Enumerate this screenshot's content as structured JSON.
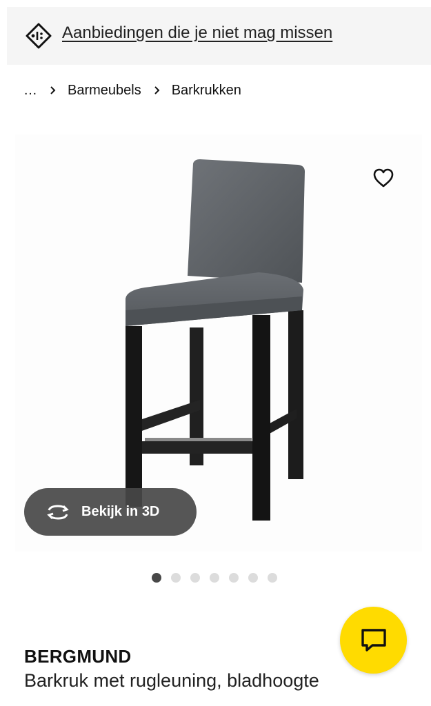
{
  "promo": {
    "icon": "tag-percent-icon",
    "link_text": "Aanbiedingen die je niet mag missen"
  },
  "breadcrumb": {
    "items": [
      "…",
      "Barmeubels",
      "Barkrukken"
    ]
  },
  "gallery": {
    "image_alt": "BERGMUND barkruk",
    "view_3d_label": "Bekijk in 3D",
    "slides_total": 7,
    "active_slide": 1
  },
  "product": {
    "name": "BERGMUND",
    "description": "Barkruk met rugleuning, bladhoogte"
  },
  "colors": {
    "accent_yellow": "#ffdb00",
    "promo_bg": "#f5f5f5",
    "pill_bg": "#484848"
  }
}
